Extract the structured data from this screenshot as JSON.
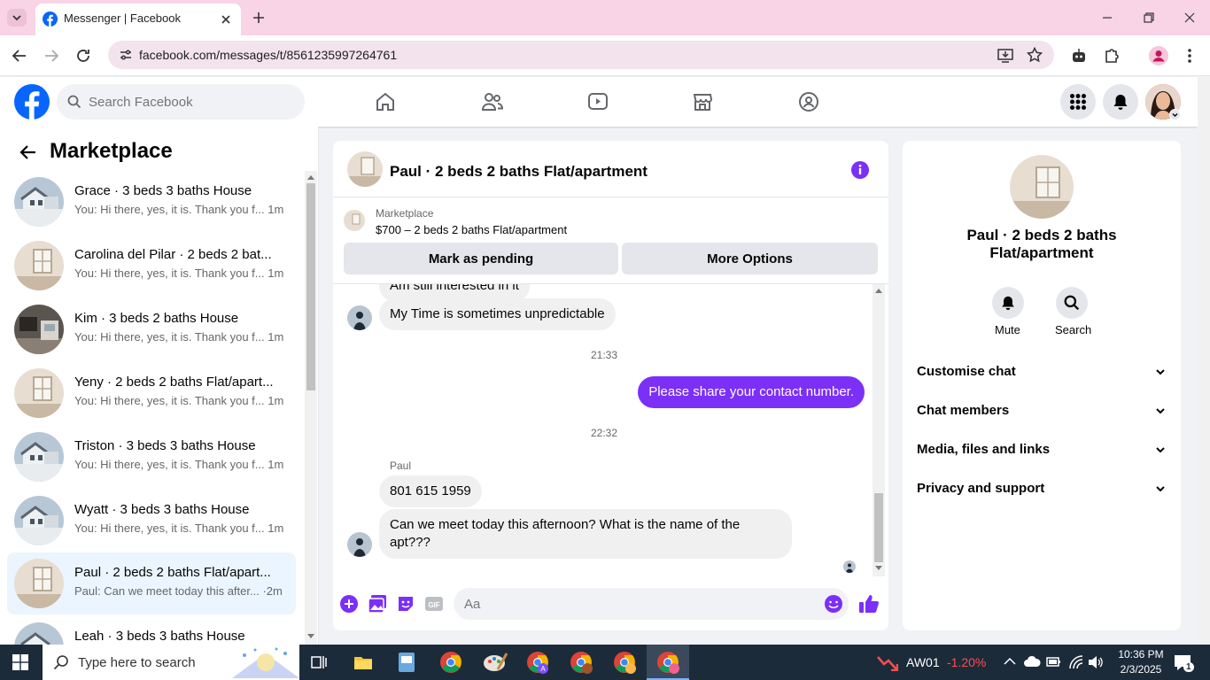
{
  "browser": {
    "tab_title": "Messenger | Facebook",
    "url": "facebook.com/messages/t/8561235997264761"
  },
  "header": {
    "search_placeholder": "Search Facebook"
  },
  "sidebar": {
    "title": "Marketplace",
    "conversations": [
      {
        "name": "Grace · 3 beds 3 baths House",
        "preview": "You: Hi there, yes, it is. Thank you f... 1m",
        "thumb": "house"
      },
      {
        "name": "Carolina del Pilar · 2 beds 2 bat...",
        "preview": "You: Hi there, yes, it is. Thank you f... 1m",
        "thumb": "room"
      },
      {
        "name": "Kim · 3 beds 2 baths House",
        "preview": "You: Hi there, yes, it is. Thank you f... 1m",
        "thumb": "kitchen"
      },
      {
        "name": "Yeny · 2 beds 2 baths Flat/apart...",
        "preview": "You: Hi there, yes, it is. Thank you f... 1m",
        "thumb": "room"
      },
      {
        "name": "Triston · 3 beds 3 baths House",
        "preview": "You: Hi there, yes, it is. Thank you f... 1m",
        "thumb": "house"
      },
      {
        "name": "Wyatt · 3 beds 3 baths House",
        "preview": "You: Hi there, yes, it is. Thank you f... 1m",
        "thumb": "house"
      },
      {
        "name": "Paul · 2 beds 2 baths Flat/apart...",
        "preview": "Paul: Can we meet today this after... ·2m",
        "thumb": "room",
        "active": true
      },
      {
        "name": "Leah · 3 beds 3 baths House",
        "preview": "",
        "thumb": "house"
      }
    ]
  },
  "chat": {
    "title": "Paul · 2 beds 2 baths Flat/apartment",
    "listing_source": "Marketplace",
    "listing_summary": "$700 – 2 beds 2 baths Flat/apartment",
    "mark_pending_label": "Mark as pending",
    "more_options_label": "More Options",
    "messages": {
      "partial": "Am still interested in it",
      "m1": "My Time is sometimes unpredictable",
      "time1": "21:33",
      "m2": "Please share your contact number.",
      "time2": "22:32",
      "sender": "Paul",
      "m3": "801 615 1959",
      "m4": "Can we meet today this afternoon?     What is the name of the apt???"
    },
    "compose_placeholder": "Aa"
  },
  "info_panel": {
    "title": "Paul · 2 beds 2 baths Flat/apartment",
    "mute_label": "Mute",
    "search_label": "Search",
    "sections": [
      "Customise chat",
      "Chat members",
      "Media, files and links",
      "Privacy and support"
    ]
  },
  "taskbar": {
    "search_placeholder": "Type here to search",
    "stock_ticker": "AW01",
    "stock_change": "-1.20%",
    "time": "10:36 PM",
    "date": "2/3/2025",
    "notification_count": "1"
  },
  "colors": {
    "accent": "#7b2ff7",
    "fb_blue": "#0866ff",
    "tab_bar": "#f8d4e6",
    "stock_red": "#ff4d4d"
  }
}
